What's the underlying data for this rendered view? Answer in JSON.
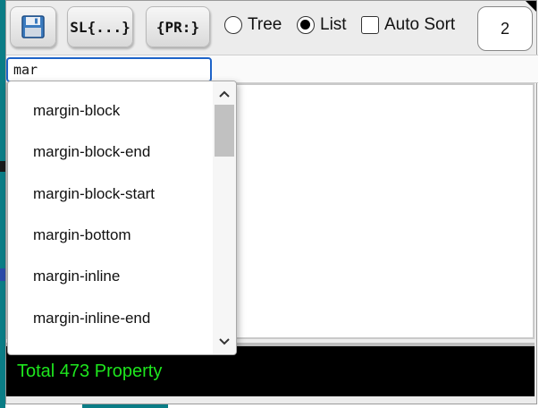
{
  "toolbar": {
    "sl_label": "SL{...}",
    "pr_label": "{PR:}",
    "tree_label": "Tree",
    "list_label": "List",
    "auto_sort_label": "Auto Sort",
    "count": "2",
    "view_mode": "List",
    "auto_sort_checked": false
  },
  "search": {
    "value": "mar"
  },
  "autocomplete": {
    "items": [
      "margin-block",
      "margin-block-end",
      "margin-block-start",
      "margin-bottom",
      "margin-inline",
      "margin-inline-end"
    ],
    "scroll_up_icon": "chevron-up-icon",
    "scroll_down_icon": "chevron-down-icon"
  },
  "status": {
    "text": "Total 473 Property",
    "color": "#1ee61e"
  },
  "colors": {
    "accent": "#1d63c9",
    "status_bg": "#000000"
  }
}
